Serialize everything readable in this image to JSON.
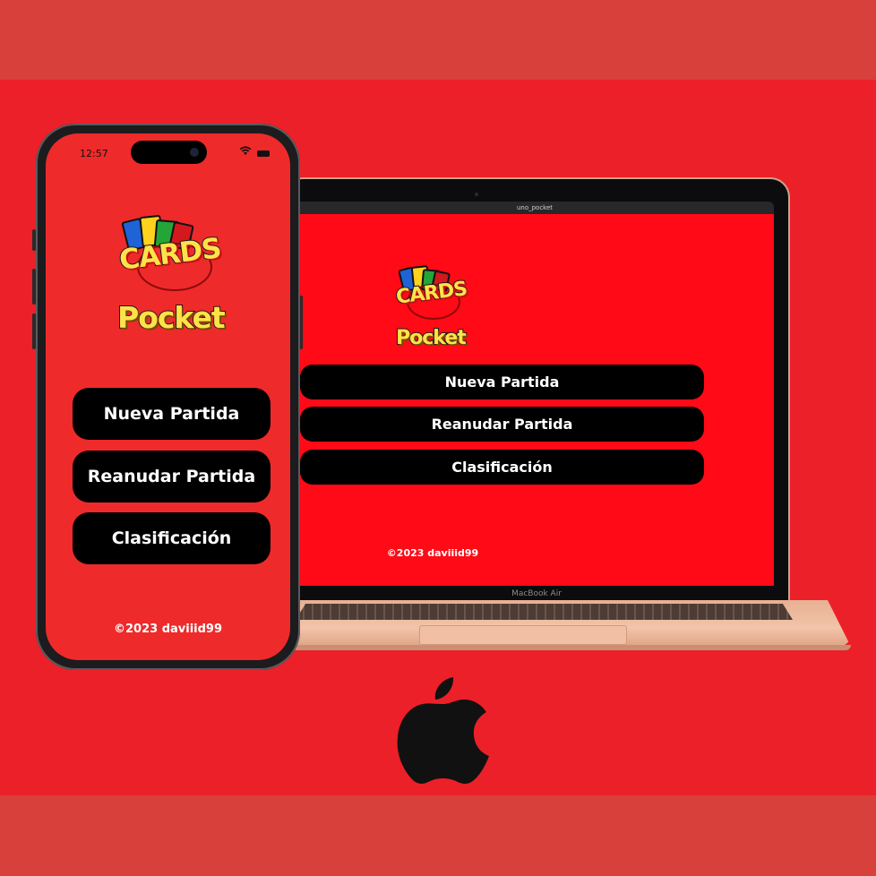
{
  "phone": {
    "status_time": "12:57",
    "buttons": [
      "Nueva Partida",
      "Reanudar Partida",
      "Clasificación"
    ],
    "footer": "©2023 daviiid99"
  },
  "laptop": {
    "window_title": "uno_pocket",
    "bezel_label": "MacBook Air",
    "buttons": [
      "Nueva Partida",
      "Reanudar Partida",
      "Clasificación"
    ],
    "footer": "©2023 daviiid99"
  },
  "logo": {
    "line1": "CARDS",
    "line2": "Pocket"
  },
  "icons": {
    "brand": "apple-logo-icon",
    "wifi": "wifi-icon",
    "battery": "battery-icon"
  },
  "colors": {
    "background": "#ec2028",
    "app_background": "#ff0a16",
    "button": "#000000",
    "logo_yellow": "#ffe24a"
  }
}
